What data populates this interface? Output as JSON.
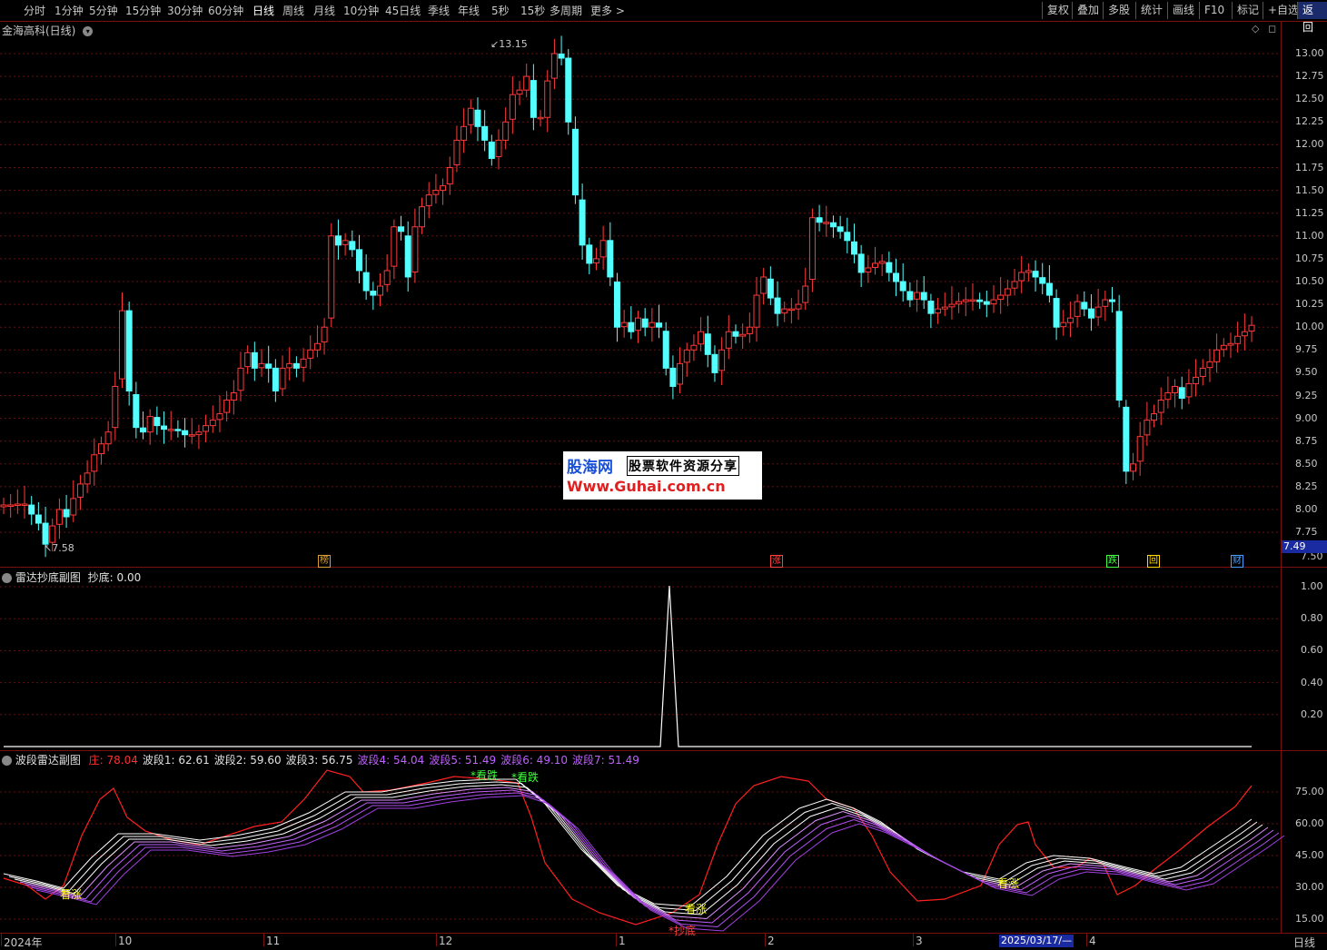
{
  "toolbar": {
    "left_items": [
      "分时",
      "1分钟",
      "5分钟",
      "15分钟",
      "30分钟",
      "60分钟",
      "日线",
      "周线",
      "月线",
      "10分钟",
      "45日线",
      "季线",
      "年线",
      "5秒",
      "15秒",
      "多周期",
      "更多 >"
    ],
    "active": "日线",
    "right_items": [
      "复权",
      "叠加",
      "多股",
      "统计",
      "画线",
      "F10",
      "标记",
      "+自选"
    ],
    "back_label": "返回"
  },
  "main_panel": {
    "title": "金海高科(日线)",
    "price_labels": [
      "13.00",
      "12.75",
      "12.50",
      "12.25",
      "12.00",
      "11.75",
      "11.50",
      "11.25",
      "11.00",
      "10.75",
      "10.50",
      "10.25",
      "10.00",
      "9.75",
      "9.50",
      "9.25",
      "9.00",
      "8.75",
      "8.50",
      "8.25",
      "8.00",
      "7.75"
    ],
    "last_price": "7.49",
    "high_mark": "13.15",
    "low_mark": "7.58",
    "bottom_cut_label": "7.50",
    "badges": [
      {
        "text": "榜",
        "color": "#d8a030"
      },
      {
        "text": "涨",
        "color": "#ff4040"
      },
      {
        "text": "跌",
        "color": "#40ff40"
      },
      {
        "text": "回",
        "color": "#ffd700"
      },
      {
        "text": "财",
        "color": "#4aa0ff"
      }
    ],
    "watermark": {
      "line1a": "股海网",
      "line1b": "股票软件资源分享",
      "line2": "Www.Guhai.com.cn"
    }
  },
  "sub_panel1": {
    "title": "雷达抄底副图",
    "indicator": "抄底: 0.00",
    "axis_labels": [
      "1.00",
      "0.80",
      "0.60",
      "0.40",
      "0.20"
    ]
  },
  "sub_panel2": {
    "title": "波段雷达副图",
    "values": [
      {
        "text": "庄: 78.04",
        "color": "#ff3030"
      },
      {
        "text": "波段1: 62.61",
        "color": "#e0e0e0"
      },
      {
        "text": "波段2: 59.60",
        "color": "#e0e0e0"
      },
      {
        "text": "波段3: 56.75",
        "color": "#e0e0e0"
      },
      {
        "text": "波段4: 54.04",
        "color": "#c060ff"
      },
      {
        "text": "波段5: 51.49",
        "color": "#c060ff"
      },
      {
        "text": "波段6: 49.10",
        "color": "#c060ff"
      },
      {
        "text": "波段7: 51.49",
        "color": "#c060ff"
      }
    ],
    "axis_labels": [
      "75.00",
      "60.00",
      "45.00",
      "30.00",
      "15.00"
    ],
    "signals": [
      {
        "text": "看涨",
        "color": "#ffff00"
      },
      {
        "text": "*看跌",
        "color": "#40ff40"
      },
      {
        "text": "*看跌",
        "color": "#40ff40"
      },
      {
        "text": "看涨",
        "color": "#ffff00"
      },
      {
        "text": "*抄底",
        "color": "#ff4040"
      },
      {
        "text": "看涨",
        "color": "#ffff00"
      }
    ]
  },
  "x_axis": {
    "labels": [
      "2024年",
      "10",
      "11",
      "12",
      "1",
      "2",
      "3",
      "4"
    ],
    "cursor_date": "2025/03/17/—",
    "period": "日线"
  },
  "colors": {
    "up": "#ff3a3a",
    "down": "#54ffff",
    "grid": "#7a1010",
    "axis_text": "#c8c8c8"
  }
}
